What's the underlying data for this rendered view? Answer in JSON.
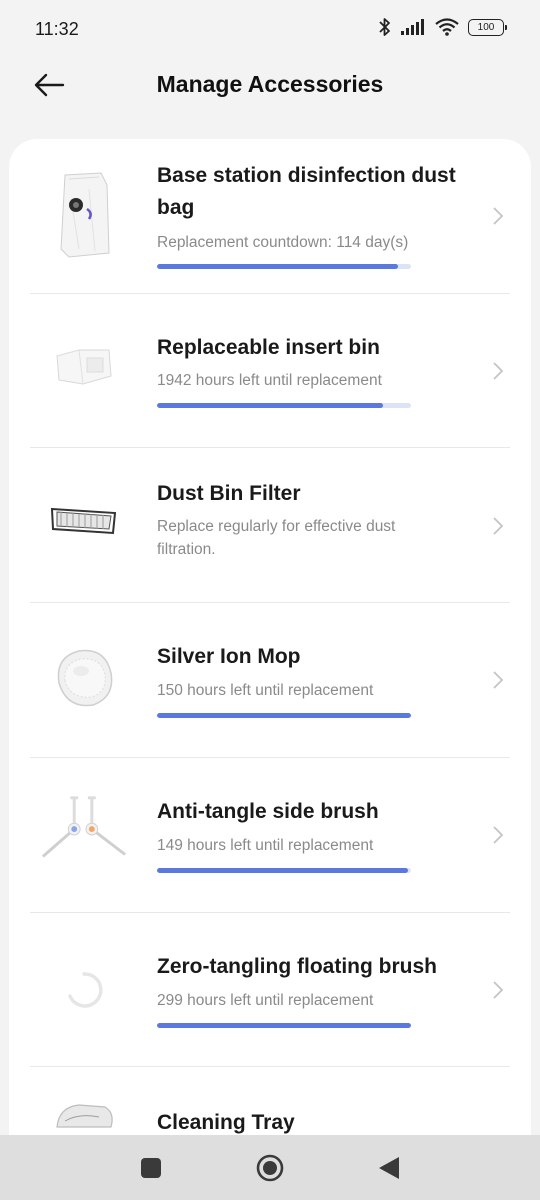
{
  "status_bar": {
    "time": "11:32",
    "battery": "100",
    "icons": [
      "bluetooth-icon",
      "signal-icon",
      "wifi-icon",
      "battery-icon"
    ]
  },
  "header": {
    "title": "Manage Accessories",
    "back_icon": "arrow-left-icon"
  },
  "colors": {
    "accent": "#5b78de",
    "progress_track": "#dde3f7",
    "card_bg": "#ffffff",
    "page_bg": "#f3f3f3"
  },
  "accessories": [
    {
      "name": "Base station disinfection dust bag",
      "subtitle": "Replacement countdown: 114 day(s)",
      "progress": 0.95,
      "image": "dust-bag-image"
    },
    {
      "name": "Replaceable insert bin",
      "subtitle": "1942 hours left until replacement",
      "progress": 0.89,
      "image": "insert-bin-image"
    },
    {
      "name": "Dust Bin Filter",
      "subtitle": "Replace regularly for effective dust filtration.",
      "image": "filter-image"
    },
    {
      "name": "Silver Ion Mop",
      "subtitle": "150 hours left until replacement",
      "progress": 1.0,
      "image": "mop-image"
    },
    {
      "name": "Anti-tangle side brush",
      "subtitle": "149 hours left until replacement",
      "progress": 0.99,
      "image": "side-brush-image"
    },
    {
      "name": "Zero-tangling floating brush",
      "subtitle": "299 hours left until replacement",
      "progress": 1.0,
      "image": "loading-spinner"
    },
    {
      "name": "Cleaning Tray",
      "image": "cleaning-tray-image"
    }
  ],
  "nav_bar": [
    "recents-icon",
    "home-icon",
    "back-icon"
  ]
}
